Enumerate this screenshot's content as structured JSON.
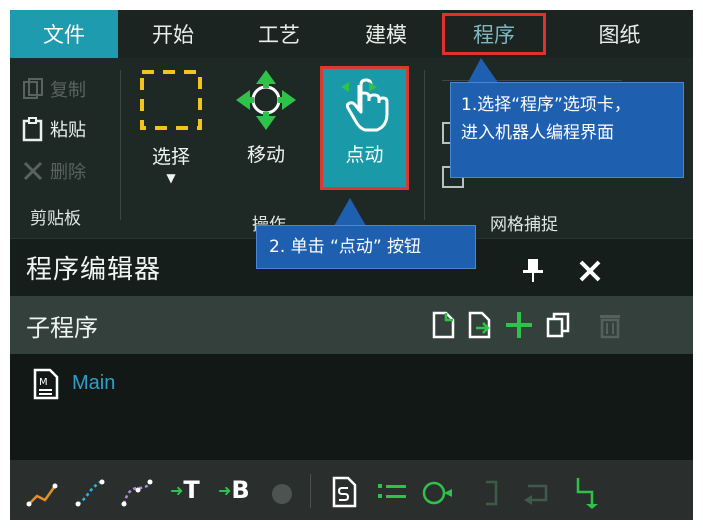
{
  "menu": {
    "tabs": [
      {
        "label": "文件"
      },
      {
        "label": "开始"
      },
      {
        "label": "工艺"
      },
      {
        "label": "建模"
      },
      {
        "label": "程序"
      },
      {
        "label": "图纸"
      }
    ]
  },
  "ribbon": {
    "clipboard": {
      "copy_label": "复制",
      "paste_label": "粘贴",
      "delete_label": "删除",
      "group_label": "剪贴板"
    },
    "operation": {
      "select_label": "选择",
      "select_arrow": "▼",
      "move_label": "移动",
      "jog_label": "点动",
      "group_label": "操作"
    },
    "grid_snap": {
      "group_label": "网格捕捉"
    }
  },
  "editor": {
    "title": "程序编辑器",
    "subprogram_label": "子程序",
    "tree_items": [
      {
        "label": "Main"
      }
    ]
  },
  "bottom_toolbar": {
    "text_items": [
      "T",
      "B"
    ]
  },
  "callouts": {
    "step1": [
      "1.选择“程序”选项卡，",
      "进入机器人编程界面"
    ],
    "step2": "2. 单击 “点动” 按钮"
  },
  "colors": {
    "active_tab": "#1f9bb0",
    "highlight_border": "#e0312e",
    "callout_bg": "#1f5fb0",
    "accent_green": "#2fc24a"
  }
}
